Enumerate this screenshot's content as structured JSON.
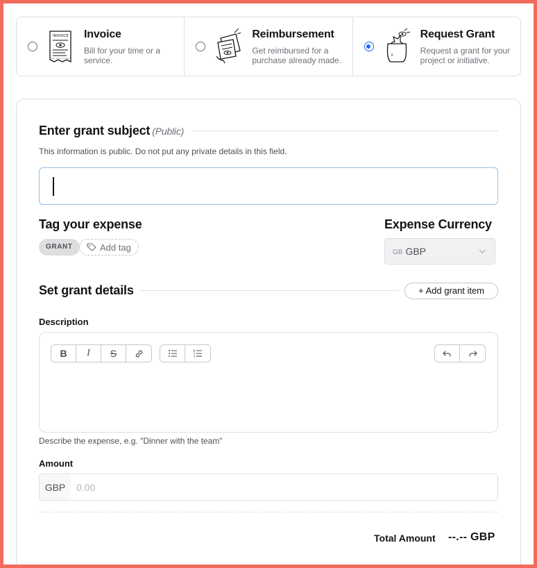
{
  "expense_types": [
    {
      "title": "Invoice",
      "description": "Bill for your time or a service.",
      "selected": false,
      "icon": "invoice-illustration"
    },
    {
      "title": "Reimbursement",
      "description": "Get reimbursed for a purchase already made.",
      "selected": false,
      "icon": "receipts-illustration"
    },
    {
      "title": "Request Grant",
      "description": "Request a grant for your project or initiative.",
      "selected": true,
      "icon": "grant-bag-illustration"
    }
  ],
  "invoice_illustration_text": "INVOICE",
  "subject": {
    "title": "Enter grant subject",
    "public_label": "(Public)",
    "help": "This information is public. Do not put any private details in this field.",
    "value": ""
  },
  "tags": {
    "title": "Tag your expense",
    "badge": "GRANT",
    "add_label": "Add tag"
  },
  "currency": {
    "title": "Expense Currency",
    "code_prefix": "GB",
    "value": "GBP"
  },
  "details": {
    "title": "Set grant details",
    "add_item_label": "+ Add grant item"
  },
  "description": {
    "label": "Description",
    "help": "Describe the expense, e.g. \"Dinner with the team\"",
    "toolbar": {
      "bold": "B",
      "italic": "I",
      "strike": "S"
    }
  },
  "amount": {
    "label": "Amount",
    "currency": "GBP",
    "placeholder": "0.00"
  },
  "total": {
    "label": "Total Amount",
    "value": "--.-- GBP"
  },
  "colors": {
    "accent": "#1869f5",
    "frame": "#f26b5b",
    "focus_border": "#8fc1ec"
  }
}
